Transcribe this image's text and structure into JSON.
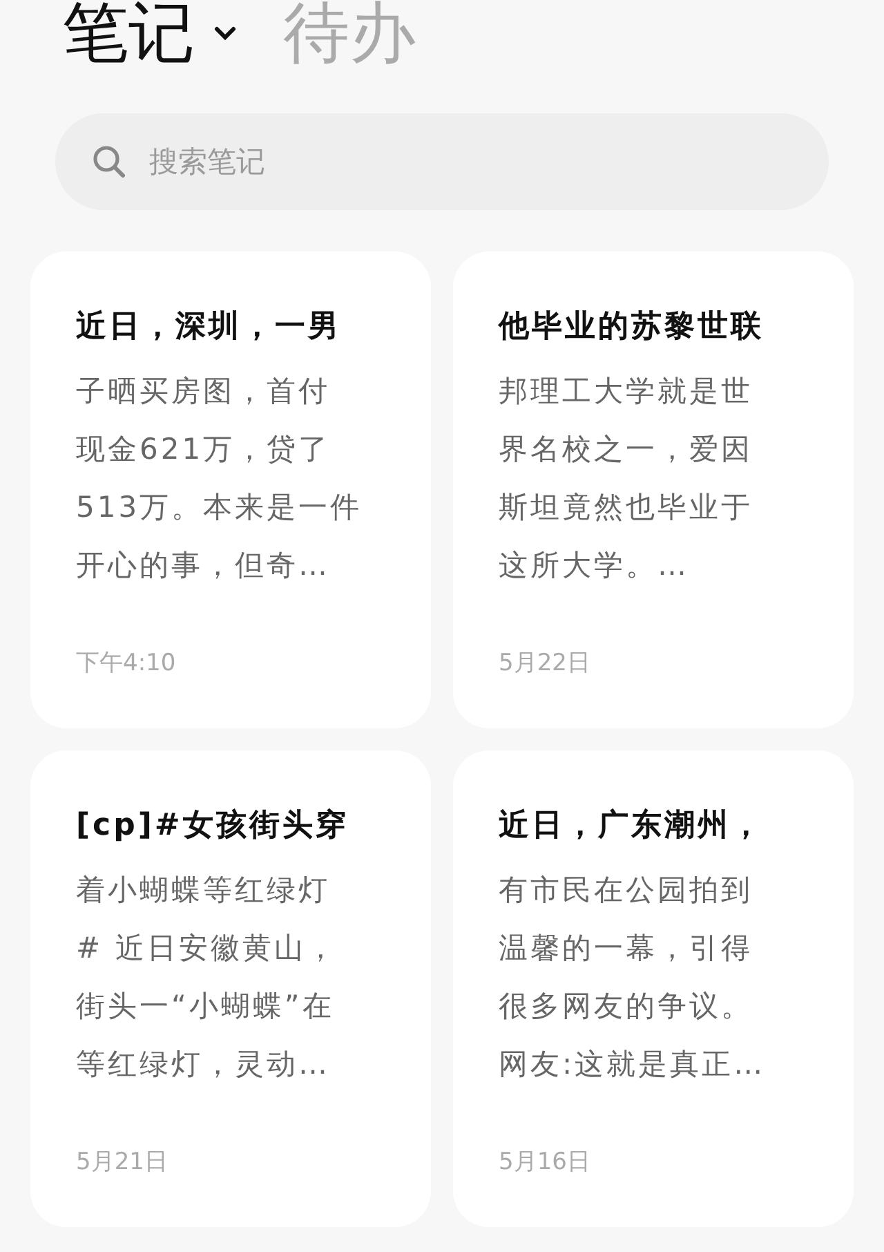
{
  "tabs": [
    {
      "label": "笔记",
      "selected": true
    },
    {
      "label": "待办",
      "selected": false
    }
  ],
  "search": {
    "placeholder": "搜索笔记"
  },
  "notes": [
    {
      "title": "近日，深圳，一男",
      "lines": [
        "子晒买房图，首付",
        "现金621万，贷了",
        "513万。本来是一件",
        "开心的事，但奇…"
      ],
      "date": "下午4:10"
    },
    {
      "title": "他毕业的苏黎世联",
      "lines": [
        "邦理工大学就是世",
        "界名校之一，爱因",
        "斯坦竟然也毕业于",
        "这所大学。…"
      ],
      "date": "5月22日"
    },
    {
      "title": "[cp]#女孩街头穿",
      "lines": [
        "着小蝴蝶等红绿灯",
        "# 近日安徽黄山，",
        "街头一“小蝴蝶”在",
        "等红绿灯，灵动…"
      ],
      "date": "5月21日"
    },
    {
      "title": "近日，广东潮州，",
      "lines": [
        "有市民在公园拍到",
        "温馨的一幕，引得",
        "很多网友的争议。",
        "网友:这就是真正…"
      ],
      "date": "5月16日"
    }
  ]
}
